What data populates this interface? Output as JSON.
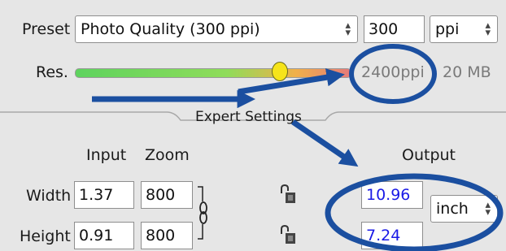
{
  "preset": {
    "label": "Preset",
    "selected": "Photo Quality (300 ppi)",
    "ppi_value": "300",
    "unit_selected": "ppi"
  },
  "resolution": {
    "label": "Res.",
    "slider_level_fraction": 0.74,
    "value_text": "2400ppi",
    "size_text": "20 MB"
  },
  "expert": {
    "header": "Expert Settings",
    "input_header": "Input",
    "zoom_header": "Zoom",
    "output_header": "Output",
    "rows": [
      {
        "label": "Width",
        "input": "1.37",
        "zoom": "800",
        "output": "10.96"
      },
      {
        "label": "Height",
        "input": "0.91",
        "zoom": "800",
        "output": "7.24"
      }
    ],
    "output_unit": "inch"
  },
  "colors": {
    "panel_bg": "#e6e6e6",
    "annotation_blue": "#1b4fa0",
    "output_text_blue": "#1a1ae6"
  },
  "icons": [
    "chain-link-icon",
    "lock-icon",
    "up-down-arrows-icon"
  ]
}
